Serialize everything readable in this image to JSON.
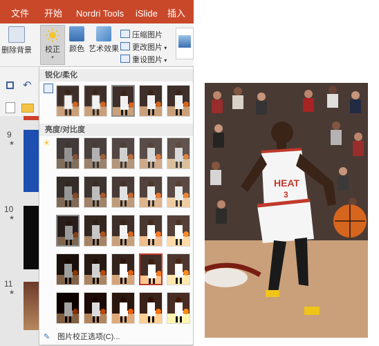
{
  "tabs": [
    "文件",
    "开始",
    "Nordri Tools",
    "iSlide",
    "插入"
  ],
  "ribbon": {
    "remove_bg": "删除背景",
    "correct": "校正",
    "color": "颜色",
    "art_effect": "艺术效果",
    "compress": "压缩图片",
    "change": "更改图片",
    "reset": "重设图片"
  },
  "slides": [
    "9",
    "10",
    "11"
  ],
  "gallery": {
    "sharpen_header": "锐化/柔化",
    "brightness_header": "亮度/对比度",
    "options_link": "图片校正选项(C)...",
    "sharpen_selected_index": 2,
    "brightness_current": {
      "row": 2,
      "col": 0
    },
    "brightness_selected": {
      "row": 3,
      "col": 3
    }
  },
  "photo": {
    "jersey_text": "HEAT",
    "number": "3"
  },
  "colors": {
    "tab_bar": "#c9482a",
    "selection": "#c0392b",
    "jersey": "#f5f5f5",
    "court": "#caa07a"
  }
}
